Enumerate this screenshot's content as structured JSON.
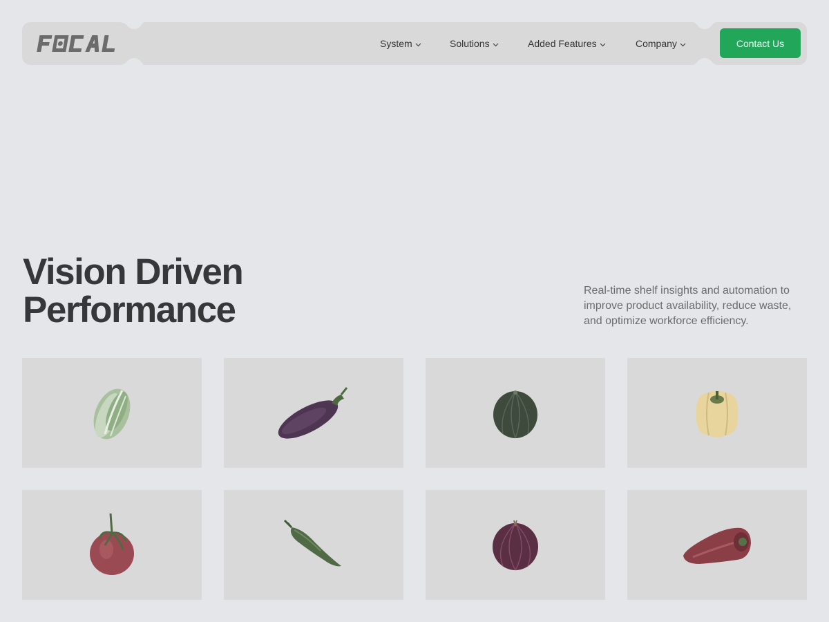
{
  "brand": {
    "logo_text": "FOCAL"
  },
  "nav": {
    "items": [
      {
        "label": "System"
      },
      {
        "label": "Solutions"
      },
      {
        "label": "Added Features"
      },
      {
        "label": "Company"
      }
    ],
    "cta_label": "Contact Us"
  },
  "hero": {
    "title_line1": "Vision Driven",
    "title_line2": "Performance",
    "subtitle": "Real-time shelf insights and automation to improve product availability, reduce waste, and optimize workforce efficiency."
  },
  "products": [
    {
      "icon": "lettuce-icon"
    },
    {
      "icon": "eggplant-icon"
    },
    {
      "icon": "round-zucchini-icon"
    },
    {
      "icon": "yellow-pepper-icon"
    },
    {
      "icon": "tomato-icon"
    },
    {
      "icon": "green-chili-icon"
    },
    {
      "icon": "red-onion-icon"
    },
    {
      "icon": "red-pepper-icon"
    }
  ],
  "colors": {
    "background": "#e5e6e9",
    "nav_bg": "#d9d9d9",
    "accent": "#22a75a",
    "tile_bg": "#d9d9d9",
    "heading": "#363738",
    "body_text": "#6a6b6d"
  }
}
